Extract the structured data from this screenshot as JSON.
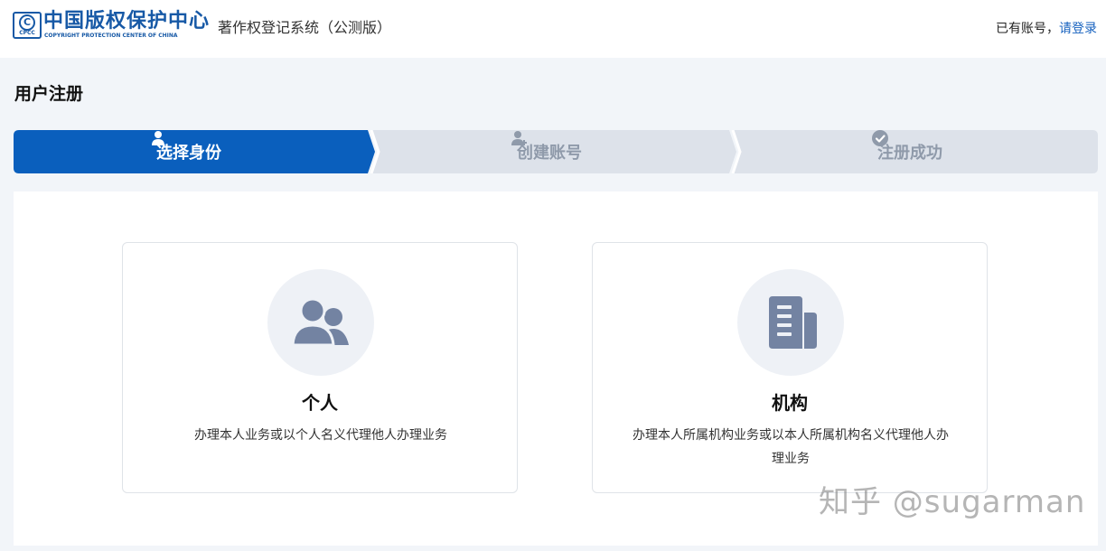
{
  "header": {
    "logo": {
      "mark_letter": "C",
      "mark_sub": "CPCC",
      "name_cn": "中国版权保护中心",
      "name_en": "COPYRIGHT PROTECTION CENTER OF CHINA"
    },
    "system_title": "著作权登记系统（公测版）",
    "login_prompt": "已有账号，",
    "login_link": "请登录"
  },
  "page_title": "用户注册",
  "steps": [
    {
      "label": "选择身份",
      "icon": "user-icon",
      "active": true
    },
    {
      "label": "创建账号",
      "icon": "user-add-icon",
      "active": false
    },
    {
      "label": "注册成功",
      "icon": "check-circle-icon",
      "active": false
    }
  ],
  "cards": [
    {
      "title": "个人",
      "description": "办理本人业务或以个人名义代理他人办理业务",
      "icon": "users-icon"
    },
    {
      "title": "机构",
      "description": "办理本人所属机构业务或以本人所属机构名义代理他人办理业务",
      "icon": "building-document-icon"
    }
  ],
  "watermark": "知乎 @sugarman",
  "colors": {
    "primary": "#0a5fbd",
    "step_inactive_bg": "#dde2ea",
    "page_bg": "#f2f5f9",
    "icon_fill": "#7383a2",
    "link": "#1762bf"
  }
}
